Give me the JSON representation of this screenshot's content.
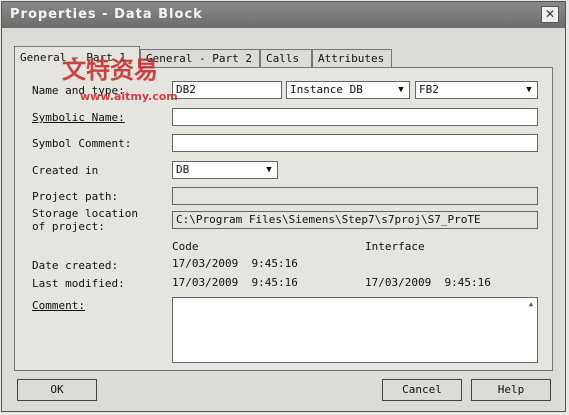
{
  "window": {
    "title": "Properties - Data Block"
  },
  "tabs": [
    {
      "label": "General - Part 1"
    },
    {
      "label": "General - Part 2"
    },
    {
      "label": "Calls"
    },
    {
      "label": "Attributes"
    }
  ],
  "fields": {
    "name_and_type": {
      "label": "Name and type:",
      "name": "DB2",
      "type": "Instance DB",
      "fb": "FB2"
    },
    "symbolic_name": {
      "label": "Symbolic Name:",
      "value": ""
    },
    "symbol_comment": {
      "label": "Symbol Comment:",
      "value": ""
    },
    "created_in": {
      "label": "Created in",
      "value": "DB"
    },
    "project_path": {
      "label": "Project path:",
      "value": ""
    },
    "storage_location": {
      "label_line1": "Storage location",
      "label_line2": "of project:",
      "value": "C:\\Program Files\\Siemens\\Step7\\s7proj\\S7_ProTE"
    },
    "column_headers": {
      "code": "Code",
      "interface": "Interface"
    },
    "date_created": {
      "label": "Date created:",
      "code": "17/03/2009  9:45:16",
      "interface": ""
    },
    "last_modified": {
      "label": "Last modified:",
      "code": "17/03/2009  9:45:16",
      "interface": "17/03/2009  9:45:16"
    },
    "comment": {
      "label": "Comment:",
      "value": ""
    }
  },
  "buttons": {
    "ok": "OK",
    "cancel": "Cancel",
    "help": "Help"
  },
  "watermark": {
    "text": "文特资易",
    "url": "www.aitmy.com"
  }
}
